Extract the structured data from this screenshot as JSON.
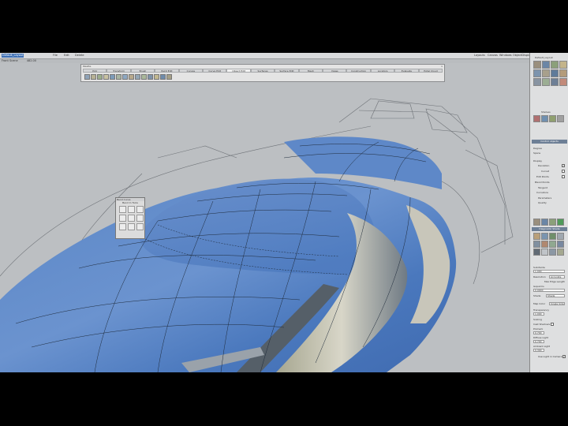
{
  "menubar": {
    "items": [
      "Default_Layout",
      "File",
      "Edit",
      "Delete",
      "Layouts",
      "Canvas",
      "Windows",
      "ObjectDisplay",
      "Help"
    ],
    "status": "Front Scene",
    "zoom": "482.00"
  },
  "palette": {
    "title": "Palette",
    "close": "x",
    "tabs": [
      "Pick",
      "Transform",
      "Brush",
      "Paint Edit",
      "Curves",
      "Curve Edit",
      "Object Edit",
      "Surfaces",
      "Surface Edit",
      "Mesh",
      "Views",
      "Construction",
      "Locators",
      "Evaluate",
      "Hotel Cloud"
    ],
    "active_tab": "Object Edit"
  },
  "curve_panel": {
    "title": "Bend Curve",
    "subtitle": "Bend In Tools"
  },
  "right_panel": {
    "top_title": "Default_Layout",
    "shelf_label": "Shelves",
    "section1": "Control objects",
    "labels1": [
      "Degree",
      "Spans",
      "Display",
      "Deviation",
      "Curvat",
      "Edit Points",
      "Blend Points",
      "Tangent",
      "Curvature",
      "Parameters",
      "Quality"
    ],
    "section2": "Layers",
    "section3": "Diagnostic Shade",
    "labels3": [
      "Subdivide",
      "Isoparms",
      "Resolution",
      "Max Edge Length",
      "Shade",
      "Map Color",
      "Transparency",
      "Scaling",
      "Cast Shadows",
      "Pinmark",
      "Diffuse Light",
      "Ambient Light",
      "Use Light in Camera"
    ],
    "values3": [
      "1.000",
      "Accurate",
      "0.0000",
      "Shade",
      "Single Side",
      "1.000",
      "0.700",
      "0.700",
      "0.300"
    ]
  },
  "colors": {
    "viewport_bg": "#bcbfc2",
    "surface_blue": "#5e88c8",
    "surface_highlight": "#c8c6ba",
    "panel_bg": "#dedfe0",
    "active_menu": "#3d6fb4",
    "panel_header": "#6d7f96"
  },
  "icons": {
    "palette_tools": [
      "select-icon",
      "move-icon",
      "rotate-icon",
      "scale-icon",
      "bend-icon",
      "twist-icon",
      "project-icon",
      "stretch-icon",
      "cut-icon",
      "align-icon",
      "offset-icon",
      "trim-icon",
      "shade-icon",
      "blend-icon"
    ],
    "curve_panel": [
      "bend-curve-icon",
      "bend-pin-icon",
      "bend-twist-icon",
      "bend-slide-icon",
      "bend-arc-icon",
      "bend-flip-icon",
      "bend-warp-icon",
      "bend-sweep-icon",
      "bend-end-icon"
    ]
  }
}
